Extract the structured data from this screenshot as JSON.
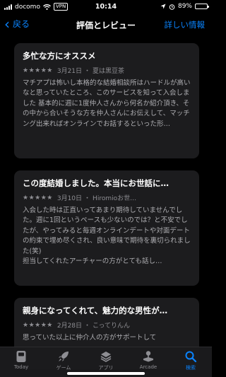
{
  "status_bar": {
    "carrier": "docomo",
    "vpn": "VPN",
    "time": "10:14",
    "battery": "89%",
    "battery_level": 0.89
  },
  "nav": {
    "back_label": "戻る",
    "title": "評価とレビュー",
    "right_label": "詳しい情報"
  },
  "reviews": [
    {
      "title": "多忙な方にオススメ",
      "stars": "★★★★★",
      "date": "3月21日",
      "separator": "・",
      "author": "夏は黒豆茶",
      "body": "マチアプは怖いし本格的な結婚相談所はハードルが高いなと思っていたところ、このサービスを知って入会しました 基本的に週に1度仲人さんから何名か紹介頂き、その中から合いそうな方を仲人さんにお伝えして、マッチング出来ればオンラインでお話するといった形…"
    },
    {
      "title": "この度結婚しました。本当にお世話に…",
      "stars": "★★★★★",
      "date": "3月10日",
      "separator": "・",
      "author": "Hiromioお世…",
      "body": "入会した時は正直いってあまり期待していませんでした。週に1回というペースも少ないのでは？と不安でしたが、やってみると毎週オンラインデートや対面デートの約束で埋め尽くされ、良い意味で期待を裏切られました(笑)\n担当してくれたアーチャーの方がとても話し…"
    },
    {
      "title": "親身になってくれて、魅力的な男性が…",
      "stars": "★★★★★",
      "date": "2月28日",
      "separator": "・",
      "author": "こってりんん",
      "body": "思っていた以上に仲介人の方がサポートして"
    }
  ],
  "tabs": [
    {
      "label": "Today",
      "icon": "today-icon",
      "active": false
    },
    {
      "label": "ゲーム",
      "icon": "rocket-icon",
      "active": false
    },
    {
      "label": "アプリ",
      "icon": "layers-icon",
      "active": false
    },
    {
      "label": "Arcade",
      "icon": "joystick-icon",
      "active": false
    },
    {
      "label": "検索",
      "icon": "search-icon",
      "active": true
    }
  ],
  "colors": {
    "accent": "#0a84ff",
    "card": "#1c1c1e",
    "background": "#000000",
    "secondary_text": "#8e8e93"
  }
}
